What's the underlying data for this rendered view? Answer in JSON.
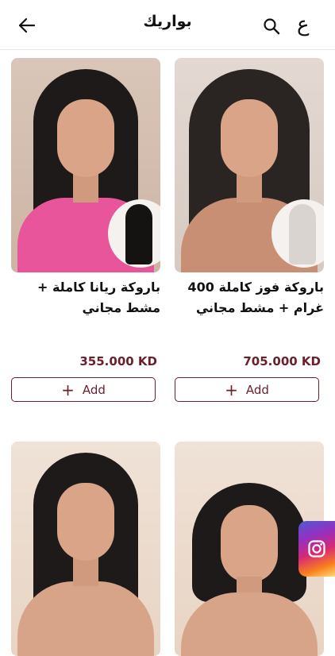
{
  "header": {
    "lang_label": "ع",
    "title": "بواريك"
  },
  "products": [
    {
      "name": "باروكة ريانا كاملة + مشط مجاني",
      "price": "355.000 KD",
      "add_label": "Add"
    },
    {
      "name": "باروكة فوز كاملة 400 غرام + مشط مجاني",
      "price": "705.000 KD",
      "add_label": "Add"
    },
    {
      "name": "",
      "price": "",
      "add_label": ""
    },
    {
      "name": "",
      "price": "",
      "add_label": ""
    }
  ],
  "icons": {
    "lang": "arabic-letter-icon",
    "search": "search-icon",
    "back": "arrow-left-icon",
    "add": "plus-icon",
    "floating": "instagram-icon"
  },
  "colors": {
    "accent": "#6b1f2b",
    "divider": "#e6e6e6"
  }
}
